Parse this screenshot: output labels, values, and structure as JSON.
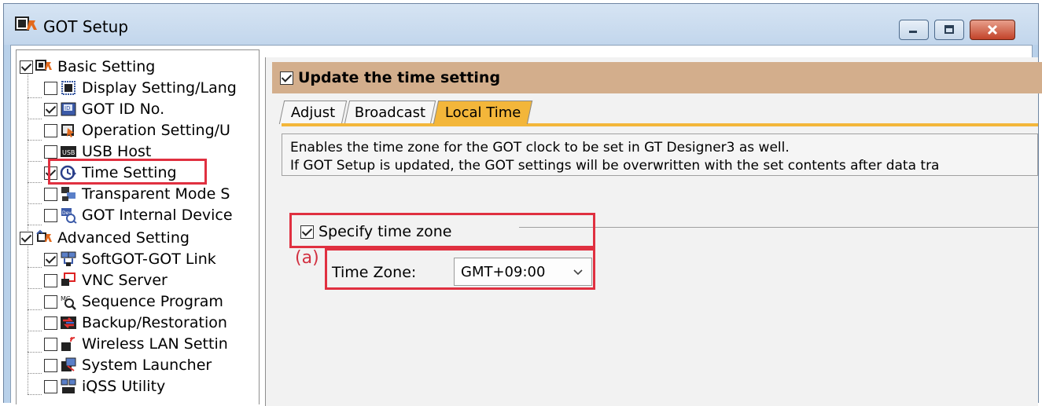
{
  "window": {
    "title": "GOT Setup",
    "buttons": [
      "minimize-icon",
      "maximize-icon",
      "close-icon"
    ]
  },
  "tree": {
    "items": [
      {
        "label": "Basic Setting",
        "checked": true,
        "icon": "basic-setting-icon"
      },
      {
        "label": "Display Setting/Lang",
        "checked": false,
        "icon": "display-icon"
      },
      {
        "label": "GOT ID No.",
        "checked": true,
        "icon": "id-icon"
      },
      {
        "label": "Operation Setting/U",
        "checked": false,
        "icon": "operation-icon"
      },
      {
        "label": "USB Host",
        "checked": false,
        "icon": "usb-icon"
      },
      {
        "label": "Time Setting",
        "checked": true,
        "icon": "clock-icon"
      },
      {
        "label": "Transparent Mode S",
        "checked": false,
        "icon": "transparent-icon"
      },
      {
        "label": "GOT Internal Device",
        "checked": false,
        "icon": "device-icon"
      },
      {
        "label": "Advanced Setting",
        "checked": true,
        "icon": "advanced-setting-icon"
      },
      {
        "label": "SoftGOT-GOT Link",
        "checked": true,
        "icon": "link-icon"
      },
      {
        "label": "VNC Server",
        "checked": false,
        "icon": "vnc-icon"
      },
      {
        "label": "Sequence Program",
        "checked": false,
        "icon": "sequence-icon"
      },
      {
        "label": "Backup/Restoration",
        "checked": false,
        "icon": "backup-icon"
      },
      {
        "label": "Wireless LAN Settin",
        "checked": false,
        "icon": "wireless-icon"
      },
      {
        "label": "System Launcher",
        "checked": false,
        "icon": "launcher-icon"
      },
      {
        "label": "iQSS Utility",
        "checked": false,
        "icon": "iqss-icon"
      }
    ]
  },
  "main": {
    "update_label": "Update the time setting",
    "update_checked": true,
    "tabs": [
      {
        "label": "Adjust",
        "active": false
      },
      {
        "label": "Broadcast",
        "active": false
      },
      {
        "label": "Local Time",
        "active": true
      }
    ],
    "description_line1": "Enables the time zone for the GOT clock to be set in GT Designer3 as well.",
    "description_line2": "If GOT Setup is updated, the GOT settings will be overwritten with the set contents after data tra",
    "specify_label": "Specify time zone",
    "specify_checked": true,
    "timezone_label": "Time Zone:",
    "timezone_value": "GMT+09:00"
  },
  "annotation": "(a)",
  "colors": {
    "header_bg": "#d3ae8c",
    "active_tab": "#f3b63a",
    "highlight": "#e03040"
  }
}
